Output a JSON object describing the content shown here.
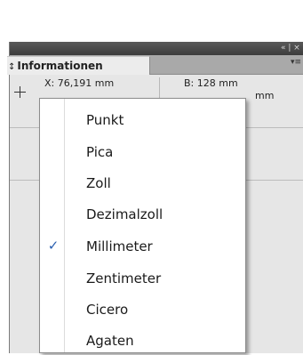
{
  "panel": {
    "title_controls": "« | ×",
    "tab_label": "Informationen",
    "tab_arrow": "↕",
    "panel_menu_icon": "▾≡",
    "x_readout": "X: 76,191 mm",
    "b_readout": "B: 128 mm",
    "h_unit_partial": "mm"
  },
  "menu": {
    "items": [
      {
        "label": "Punkt",
        "checked": false
      },
      {
        "label": "Pica",
        "checked": false
      },
      {
        "label": "Zoll",
        "checked": false
      },
      {
        "label": "Dezimalzoll",
        "checked": false
      },
      {
        "label": "Millimeter",
        "checked": true
      },
      {
        "label": "Zentimeter",
        "checked": false
      },
      {
        "label": "Cicero",
        "checked": false
      },
      {
        "label": "Agaten",
        "checked": false
      }
    ],
    "check_glyph": "✓"
  },
  "colors": {
    "check": "#2a5fb0",
    "titlebar": "#4a4a4a",
    "panel_bg": "#e6e6e6"
  }
}
